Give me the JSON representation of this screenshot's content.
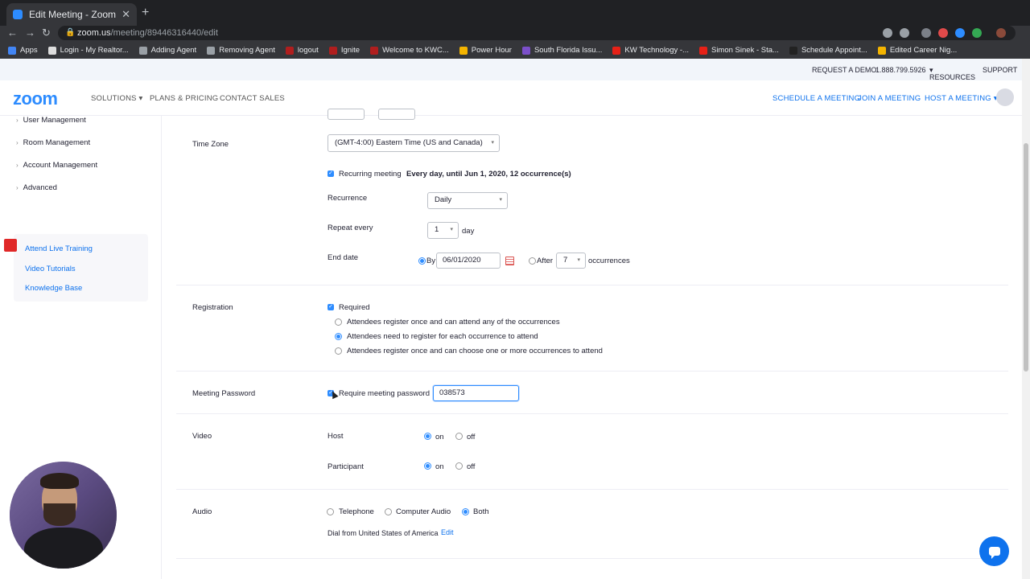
{
  "browser": {
    "tab_title": "Edit Meeting - Zoom",
    "url_host": "zoom.us",
    "url_path": "/meeting/89446316440/edit",
    "bookmarks": [
      "Apps",
      "Login - My Realtor...",
      "Adding Agent",
      "Removing Agent",
      "logout",
      "Ignite",
      "Welcome to KWC...",
      "Power Hour",
      "South Florida Issu...",
      "KW Technology -...",
      "Simon Sinek - Sta...",
      "Schedule Appoint...",
      "Edited Career Nig..."
    ]
  },
  "header": {
    "request_demo": "REQUEST A DEMO",
    "phone": "1.888.799.5926",
    "resources": "RESOURCES",
    "support": "SUPPORT",
    "logo": "zoom",
    "solutions": "SOLUTIONS",
    "plans": "PLANS & PRICING",
    "contact": "CONTACT SALES",
    "schedule": "SCHEDULE A MEETING",
    "join": "JOIN A MEETING",
    "host": "HOST A MEETING"
  },
  "sidebar": {
    "items": [
      "User Management",
      "Room Management",
      "Account Management",
      "Advanced"
    ],
    "help": [
      "Attend Live Training",
      "Video Tutorials",
      "Knowledge Base"
    ]
  },
  "form": {
    "timezone_label": "Time Zone",
    "timezone_value": "(GMT-4:00) Eastern Time (US and Canada)",
    "recurring_label": "Recurring meeting",
    "recurring_summary": "Every day, until Jun 1, 2020, 12 occurrence(s)",
    "recurrence_label": "Recurrence",
    "recurrence_value": "Daily",
    "repeat_label": "Repeat every",
    "repeat_value": "1",
    "repeat_unit": "day",
    "end_label": "End date",
    "end_by": "By",
    "end_date": "06/01/2020",
    "end_after": "After",
    "occurrences_value": "7",
    "occurrences_unit": "occurrences",
    "registration_label": "Registration",
    "registration_required": "Required",
    "reg_option_1": "Attendees register once and can attend any of the occurrences",
    "reg_option_2": "Attendees need to register for each occurrence to attend",
    "reg_option_3": "Attendees register once and can choose one or more occurrences to attend",
    "password_label": "Meeting Password",
    "password_check": "Require meeting password",
    "password_value": "038573",
    "video_label": "Video",
    "host_label": "Host",
    "participant_label": "Participant",
    "on": "on",
    "off": "off",
    "audio_label": "Audio",
    "audio_telephone": "Telephone",
    "audio_computer": "Computer Audio",
    "audio_both": "Both",
    "dial_from": "Dial from United States of America",
    "edit": "Edit"
  },
  "colors": {
    "accent": "#2d8cff",
    "link": "#0e72ed"
  }
}
